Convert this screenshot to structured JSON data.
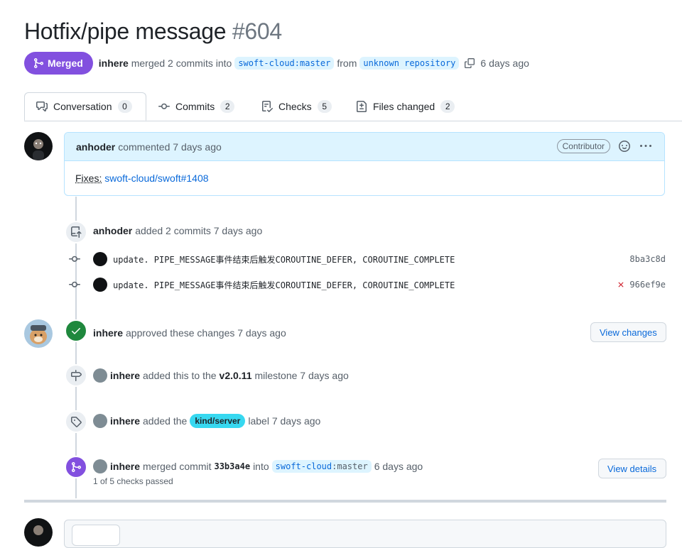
{
  "pr": {
    "title": "Hotfix/pipe message",
    "number": "#604",
    "state_label": "Merged",
    "author": "inhere",
    "merged_text": "merged 2 commits into",
    "base_branch": "swoft-cloud:master",
    "from_text": "from",
    "head_branch": "unknown repository",
    "time": "6 days ago"
  },
  "tabs": [
    {
      "label": "Conversation",
      "count": "0"
    },
    {
      "label": "Commits",
      "count": "2"
    },
    {
      "label": "Checks",
      "count": "5"
    },
    {
      "label": "Files changed",
      "count": "2"
    }
  ],
  "comment": {
    "author": "anhoder",
    "action": "commented 7 days ago",
    "role": "Contributor",
    "fixes_label": "Fixes:",
    "fixes_link": "swoft-cloud/swoft#1408"
  },
  "commits_event": {
    "author": "anhoder",
    "text": "added 2 commits 7 days ago",
    "commits": [
      {
        "message": "update. PIPE_MESSAGE事件结束后触发COROUTINE_DEFER, COROUTINE_COMPLETE",
        "sha": "8ba3c8d",
        "failed": false
      },
      {
        "message": "update. PIPE_MESSAGE事件结束后触发COROUTINE_DEFER, COROUTINE_COMPLETE",
        "sha": "966ef9e",
        "failed": true
      }
    ]
  },
  "approval": {
    "author": "inhere",
    "text": "approved these changes 7 days ago",
    "button": "View changes"
  },
  "milestone": {
    "author": "inhere",
    "pre": "added this to the",
    "name": "v2.0.11",
    "post": "milestone 7 days ago"
  },
  "label_event": {
    "author": "inhere",
    "pre": "added the",
    "label": "kind/server",
    "post": "label 7 days ago"
  },
  "merge_event": {
    "author": "inhere",
    "pre": "merged commit",
    "sha": "33b3a4e",
    "into": "into",
    "branch_owner": "swoft-cloud",
    "branch_sep": ":",
    "branch_name": "master",
    "time": "6 days ago",
    "checks": "1 of 5 checks passed",
    "button": "View details"
  },
  "colors": {
    "merged": "#8250df",
    "approved": "#1f883d",
    "link": "#0969da",
    "label": "#37d8f0",
    "failed": "#cf222e"
  }
}
